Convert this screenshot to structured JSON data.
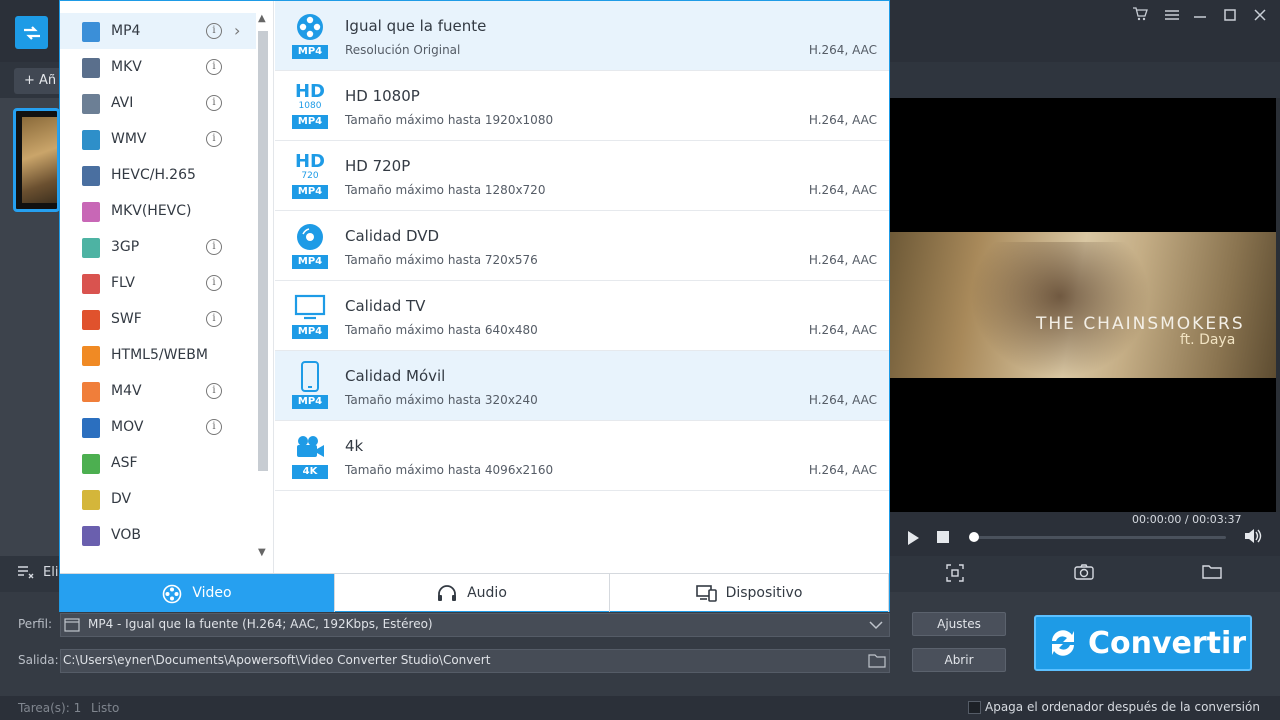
{
  "titlebar": {
    "icons": [
      "cart-icon",
      "list-icon",
      "minimize-icon",
      "maximize-icon",
      "close-icon"
    ]
  },
  "toolbar": {
    "add_label": "+ Añ"
  },
  "preview": {
    "overlay_title": "THE CHAINSMOKERS",
    "overlay_sub": "ft. Daya",
    "time": "00:00:00 / 00:03:37"
  },
  "bottom_toolbar": {
    "delete_label": "Elin"
  },
  "settings": {
    "profile_label": "Perfil:",
    "profile_value": "MP4 - Igual que la fuente (H.264; AAC, 192Kbps, Estéreo)",
    "output_label": "Salida:",
    "output_value": "C:\\Users\\eyner\\Documents\\Apowersoft\\Video Converter Studio\\Convert",
    "settings_button": "Ajustes",
    "open_button": "Abrir",
    "convert_button": "Convertir"
  },
  "status": {
    "tasks": "Tarea(s): 1",
    "state": "Listo",
    "shutdown_label": "Apaga el ordenador después de la conversión"
  },
  "popup": {
    "categories": [
      {
        "label": "MP4",
        "color": "#3b8fd8",
        "info": true,
        "selected": true
      },
      {
        "label": "MKV",
        "color": "#5a6f8c",
        "info": true
      },
      {
        "label": "AVI",
        "color": "#6c7f95",
        "info": true
      },
      {
        "label": "WMV",
        "color": "#2e8fc9",
        "info": true
      },
      {
        "label": "HEVC/H.265",
        "color": "#4a6fa0",
        "info": false
      },
      {
        "label": "MKV(HEVC)",
        "color": "#c867b6",
        "info": false
      },
      {
        "label": "3GP",
        "color": "#4db3a3",
        "info": true
      },
      {
        "label": "FLV",
        "color": "#d9534f",
        "info": true
      },
      {
        "label": "SWF",
        "color": "#e0522d",
        "info": true
      },
      {
        "label": "HTML5/WEBM",
        "color": "#f08a24",
        "info": false
      },
      {
        "label": "M4V",
        "color": "#f07e3a",
        "info": true
      },
      {
        "label": "MOV",
        "color": "#2b6fbf",
        "info": true
      },
      {
        "label": "ASF",
        "color": "#4caf50",
        "info": false
      },
      {
        "label": "DV",
        "color": "#d4b63a",
        "info": false
      },
      {
        "label": "VOB",
        "color": "#6a5fae",
        "info": false
      }
    ],
    "presets": [
      {
        "title": "Igual que la fuente",
        "subtitle": "Resolución Original",
        "codec": "H.264, AAC",
        "badge": "MP4",
        "glyph": "film-reel-icon",
        "selected": true
      },
      {
        "title": "HD 1080P",
        "subtitle": "Tamaño máximo hasta 1920x1080",
        "codec": "H.264, AAC",
        "badge": "MP4",
        "glyph": "hd-1080-icon",
        "glyph_top": "HD",
        "glyph_bottom": "1080"
      },
      {
        "title": "HD 720P",
        "subtitle": "Tamaño máximo hasta 1280x720",
        "codec": "H.264, AAC",
        "badge": "MP4",
        "glyph": "hd-720-icon",
        "glyph_top": "HD",
        "glyph_bottom": "720"
      },
      {
        "title": "Calidad DVD",
        "subtitle": "Tamaño máximo hasta 720x576",
        "codec": "H.264, AAC",
        "badge": "MP4",
        "glyph": "disc-icon"
      },
      {
        "title": "Calidad TV",
        "subtitle": "Tamaño máximo hasta 640x480",
        "codec": "H.264, AAC",
        "badge": "MP4",
        "glyph": "monitor-icon"
      },
      {
        "title": "Calidad Móvil",
        "subtitle": "Tamaño máximo hasta 320x240",
        "codec": "H.264, AAC",
        "badge": "MP4",
        "glyph": "phone-icon",
        "selected": true
      },
      {
        "title": "4k",
        "subtitle": "Tamaño máximo hasta 4096x2160",
        "codec": "H.264, AAC",
        "badge": "4K",
        "glyph": "camera-icon"
      }
    ],
    "tabs": [
      {
        "label": "Video",
        "icon": "film-reel-icon",
        "active": true
      },
      {
        "label": "Audio",
        "icon": "headphones-icon"
      },
      {
        "label": "Dispositivo",
        "icon": "devices-icon"
      }
    ]
  },
  "colors": {
    "accent": "#1e9be6",
    "selected_row": "#e8f3fc"
  }
}
